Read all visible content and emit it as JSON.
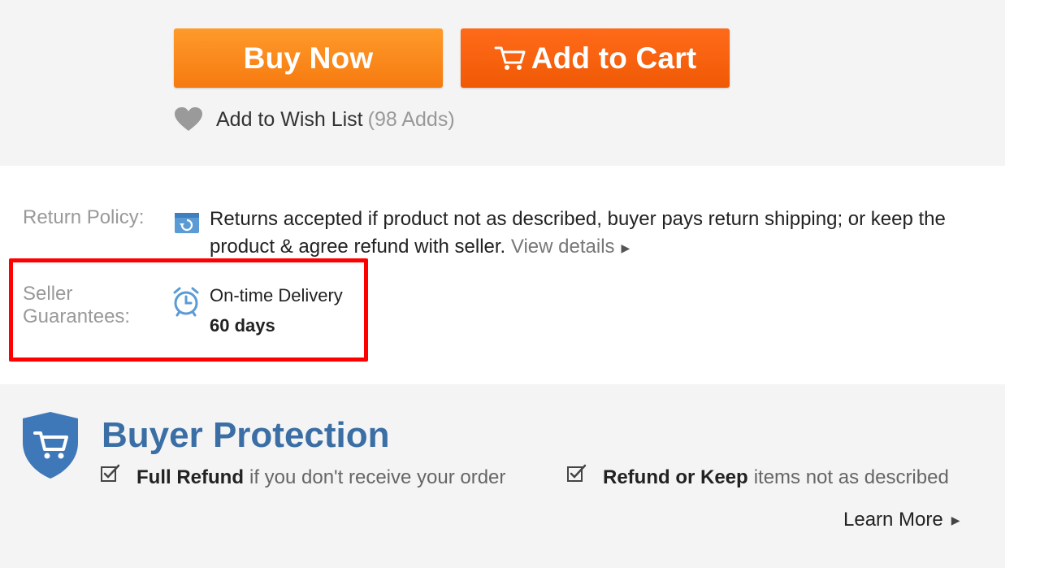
{
  "actions": {
    "buy_now_label": "Buy Now",
    "add_to_cart_label": "Add to Cart",
    "wish_list_label": "Add to Wish List",
    "wish_list_count": "(98 Adds)"
  },
  "policy": {
    "return_label": "Return Policy:",
    "return_text": "Returns accepted if product not as described, buyer pays return shipping; or keep the product & agree refund with seller.",
    "view_details_label": "View details",
    "seller_label": "Seller Guarantees:",
    "on_time_label": "On-time Delivery",
    "delivery_days": "60 days"
  },
  "buyer_protection": {
    "title": "Buyer Protection",
    "item1_bold": "Full Refund",
    "item1_rest": "if you don't receive your order",
    "item2_bold": "Refund or Keep",
    "item2_rest": "items not as described",
    "learn_more_label": "Learn More"
  },
  "colors": {
    "buy_now": "#f7861a",
    "add_to_cart": "#f25c05",
    "highlight_border": "#ff0000",
    "title_blue": "#3a6ea5",
    "icon_blue": "#5b9bd5"
  },
  "icons": {
    "cart": "cart-icon",
    "heart": "heart-icon",
    "return": "return-icon",
    "clock": "alarm-clock-icon",
    "shield": "shield-cart-icon",
    "check": "checkbox-icon"
  }
}
